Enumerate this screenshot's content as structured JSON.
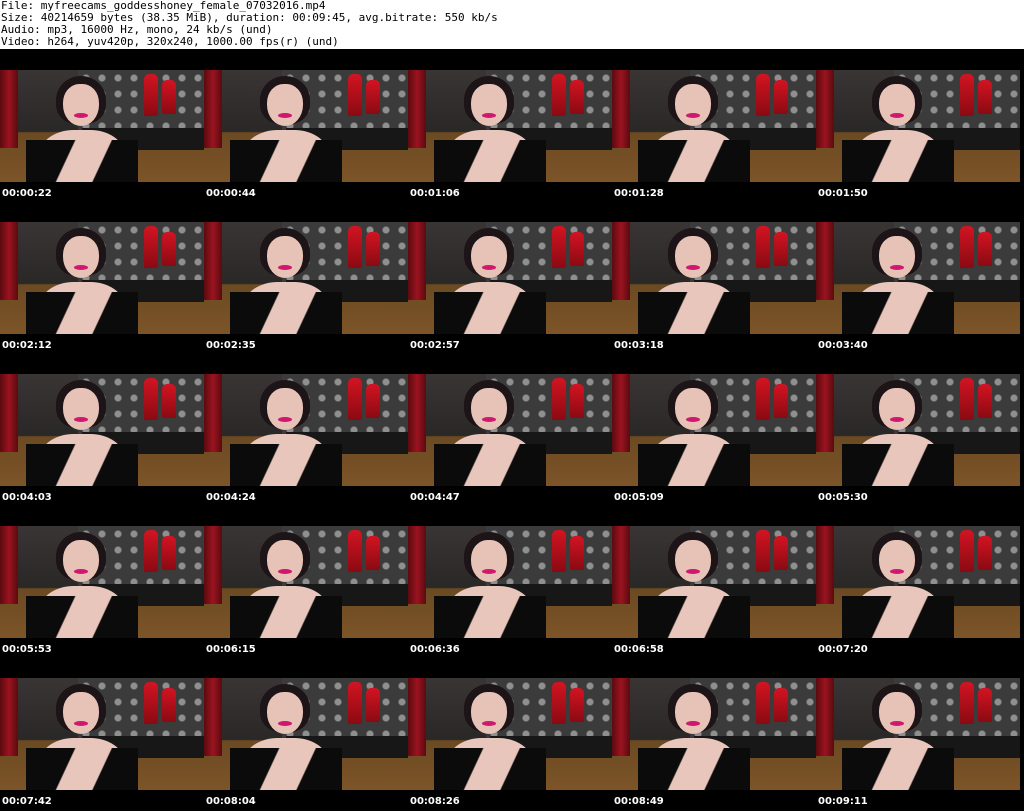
{
  "info": {
    "file": "File: myfreecams_goddesshoney_female_07032016.mp4",
    "size": "Size: 40214659 bytes (38.35 MiB), duration: 00:09:45, avg.bitrate: 550 kb/s",
    "audio": "Audio: mp3, 16000 Hz, mono, 24 kb/s (und)",
    "video": "Video: h264, yuv420p, 320x240, 1000.00 fps(r) (und)"
  },
  "frames": [
    {
      "time": "00:00:22"
    },
    {
      "time": "00:00:44"
    },
    {
      "time": "00:01:06"
    },
    {
      "time": "00:01:28"
    },
    {
      "time": "00:01:50"
    },
    {
      "time": "00:02:12"
    },
    {
      "time": "00:02:35"
    },
    {
      "time": "00:02:57"
    },
    {
      "time": "00:03:18"
    },
    {
      "time": "00:03:40"
    },
    {
      "time": "00:04:03"
    },
    {
      "time": "00:04:24"
    },
    {
      "time": "00:04:47"
    },
    {
      "time": "00:05:09"
    },
    {
      "time": "00:05:30"
    },
    {
      "time": "00:05:53"
    },
    {
      "time": "00:06:15"
    },
    {
      "time": "00:06:36"
    },
    {
      "time": "00:06:58"
    },
    {
      "time": "00:07:20"
    },
    {
      "time": "00:07:42"
    },
    {
      "time": "00:08:04"
    },
    {
      "time": "00:08:26"
    },
    {
      "time": "00:08:49"
    },
    {
      "time": "00:09:11"
    }
  ]
}
